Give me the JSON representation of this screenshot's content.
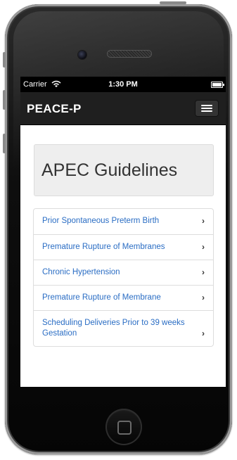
{
  "status_bar": {
    "carrier": "Carrier",
    "time": "1:30 PM"
  },
  "navbar": {
    "brand": "PEACE-P"
  },
  "hero": {
    "title": "APEC Guidelines"
  },
  "guidelines": [
    {
      "label": "Prior Spontaneous Preterm Birth",
      "chevron": "›"
    },
    {
      "label": "Premature Rupture of Membranes",
      "chevron": "›"
    },
    {
      "label": "Chronic Hypertension",
      "chevron": "›"
    },
    {
      "label": "Premature Rupture of Membrane",
      "chevron": "›"
    },
    {
      "label": "Scheduling Deliveries Prior to 39 weeks Gestation",
      "chevron": "›"
    }
  ],
  "colors": {
    "link": "#2a6dc4",
    "navbar": "#1f1f1f",
    "hero_bg": "#eeeeee"
  },
  "icons": {
    "wifi": "wifi-icon",
    "battery": "battery-icon",
    "menu": "hamburger-menu-icon",
    "chevron": "chevron-right-icon",
    "home": "home-button-icon"
  }
}
